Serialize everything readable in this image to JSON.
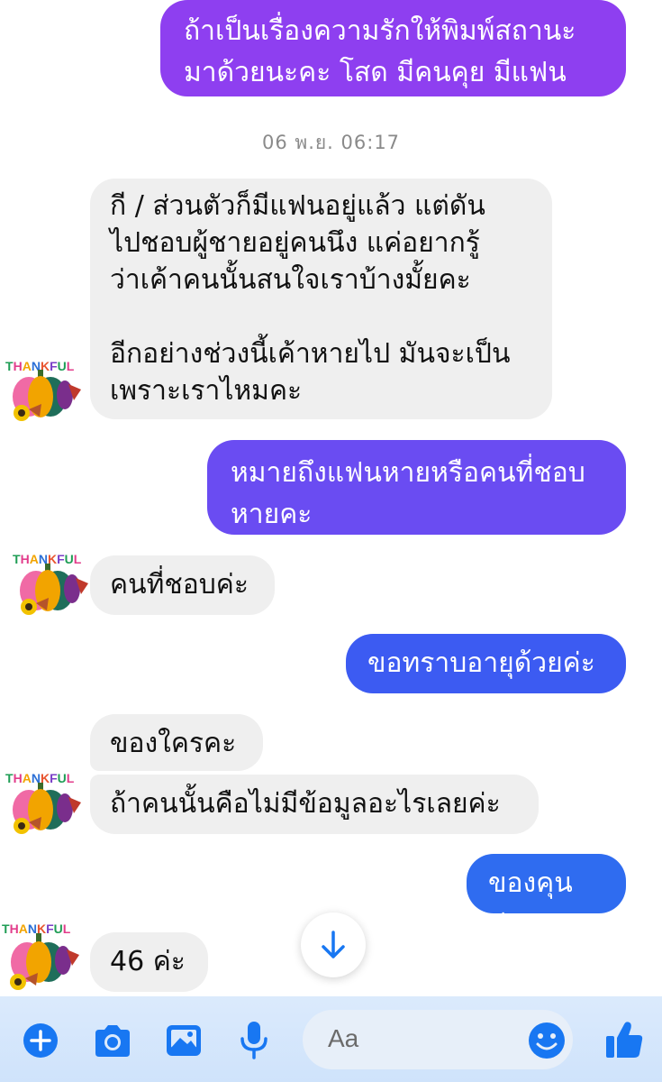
{
  "messages": [
    {
      "side": "out",
      "text": "ถ้าเป็นเรื่องความรักให้พิมพ์สถานะ\nมาด้วยนะคะ โสด มีคนคุย มีแฟน"
    },
    {
      "side": "in",
      "text": "กี / ส่วนตัวก็มีแฟนอยู่แล้ว แต่ดัน\nไปชอบผู้ชายอยู่คนนึง  แค่อยากรู้\nว่าเค้าคนนั้นสนใจเราบ้างมั้ยคะ\n\nอีกอย่างช่วงนี้เค้าหายไป มันจะเป็น\nเพราะเราไหมคะ"
    },
    {
      "side": "out",
      "text": "หมายถึงแฟนหายหรือคนที่ชอบ\nหายคะ"
    },
    {
      "side": "in",
      "text": "คนที่ชอบค่ะ"
    },
    {
      "side": "out",
      "text": "ขอทราบอายุด้วยค่ะ"
    },
    {
      "side": "in",
      "text": "ของใครคะ"
    },
    {
      "side": "in",
      "text": "ถ้าคนนั้นคือไม่มีข้อมูลอะไรเลยค่ะ"
    },
    {
      "side": "out",
      "text": "ของคุนค่ะ"
    },
    {
      "side": "in",
      "text": "46 ค่ะ"
    }
  ],
  "timestamp": "06 พ.ย. 06:17",
  "avatar": {
    "label": "THANKFUL",
    "letters": [
      "T",
      "H",
      "A",
      "N",
      "K",
      "F",
      "U",
      "L"
    ]
  },
  "composer": {
    "placeholder": "Aa"
  },
  "colors": {
    "out_purple": "#8e3ff0",
    "out_violet": "#6a4cf2",
    "out_blue": "#3c5bf2",
    "out_royal": "#2f6cf0",
    "incoming": "#efefef",
    "accent": "#1877f2"
  },
  "icons": [
    "plus-icon",
    "camera-icon",
    "image-icon",
    "microphone-icon",
    "emoji-icon",
    "thumbs-up-icon",
    "arrow-down-icon"
  ]
}
